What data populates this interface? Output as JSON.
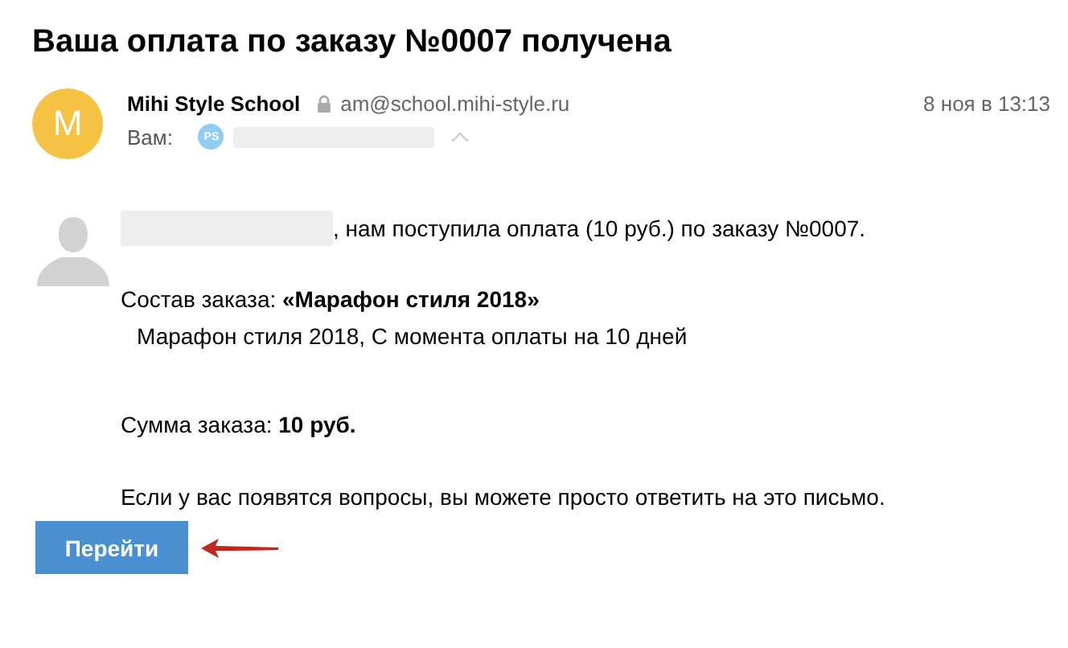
{
  "subject": "Ваша оплата по заказу №0007 получена",
  "sender": {
    "avatar_letter": "M",
    "name": "Mihi Style School",
    "email": "am@school.mihi-style.ru",
    "date": "8 ноя в 13:13"
  },
  "recipients": {
    "label": "Вам:",
    "badge": "PS"
  },
  "body": {
    "greeting": ", нам поступила оплата (10 руб.) по заказу №0007.",
    "order": "Состав заказа: **«Марафон стиля 2018»**",
    "order_item": "Марафон стиля 2018, С момента оплаты на 10 дней",
    "total": "Сумма заказа: **10 руб.**",
    "note": "Если у вас появятся вопросы, вы можете просто ответить на это письмо.",
    "button": "Перейти"
  }
}
